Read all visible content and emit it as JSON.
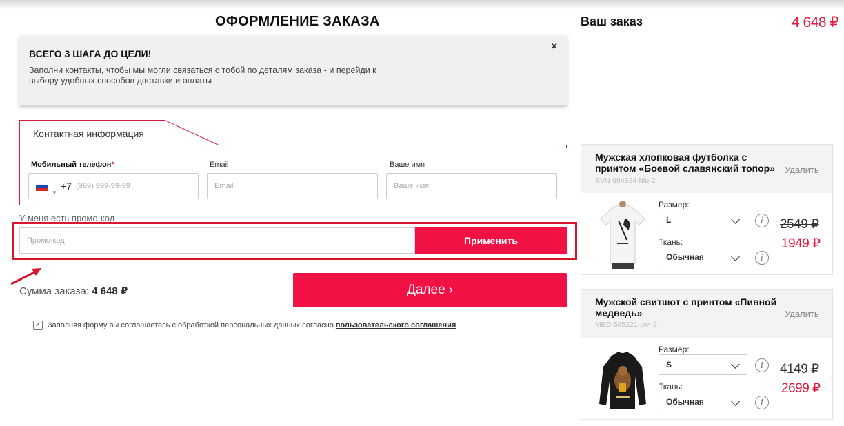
{
  "header": {
    "page_title": "ОФОРМЛЕНИЕ ЗАКАЗА",
    "order_title": "Ваш заказ",
    "order_total": "4 648 ₽"
  },
  "banner": {
    "title": "ВСЕГО 3 ШАГА ДО ЦЕЛИ!",
    "text": "Заполни контакты, чтобы мы могли связаться с тобой по деталям заказа - и перейди к выбору удобных способов доставки и оплаты",
    "close": "×"
  },
  "contact": {
    "section_title": "Контактная информация",
    "phone_label": "Мобильный телефон",
    "required_mark": "*",
    "phone_code": "+7",
    "phone_placeholder": "(999) 999-99-99",
    "email_label": "Email",
    "email_placeholder": "Email",
    "name_label": "Ваше имя",
    "name_placeholder": "Ваше имя"
  },
  "promo": {
    "label": "У меня есть промо-код",
    "placeholder": "Промо-код",
    "apply": "Применить"
  },
  "summary": {
    "label": "Сумма заказа:",
    "value": "4 648 ₽",
    "next": "Далее"
  },
  "agreement": {
    "text": "Заполняя форму вы соглашаетесь с обработкой персональных данных согласно",
    "link": "пользовательского соглашения"
  },
  "cart": [
    {
      "name": "Мужская хлопковая футболка с принтом «Боевой славянский топор»",
      "sku": "SVN-994624-hfu-2",
      "remove": "Удалить",
      "size_label": "Размер:",
      "size": "L",
      "fabric_label": "Ткань:",
      "fabric": "Обычная",
      "old_price": "2549 ₽",
      "new_price": "1949 ₽",
      "image_icon": "white-tshirt-with-axe-print"
    },
    {
      "name": "Мужской свитшот с принтом «Пивной медведь»",
      "sku": "MED-585221-swi-2",
      "remove": "Удалить",
      "size_label": "Размер:",
      "size": "S",
      "fabric_label": "Ткань:",
      "fabric": "Обычная",
      "old_price": "4149 ₽",
      "new_price": "2699 ₽",
      "image_icon": "black-sweatshirt-with-bear-print"
    }
  ],
  "colors": {
    "accent": "#f11144",
    "price_red": "#e2183d",
    "highlight_box": "#d8162c"
  }
}
